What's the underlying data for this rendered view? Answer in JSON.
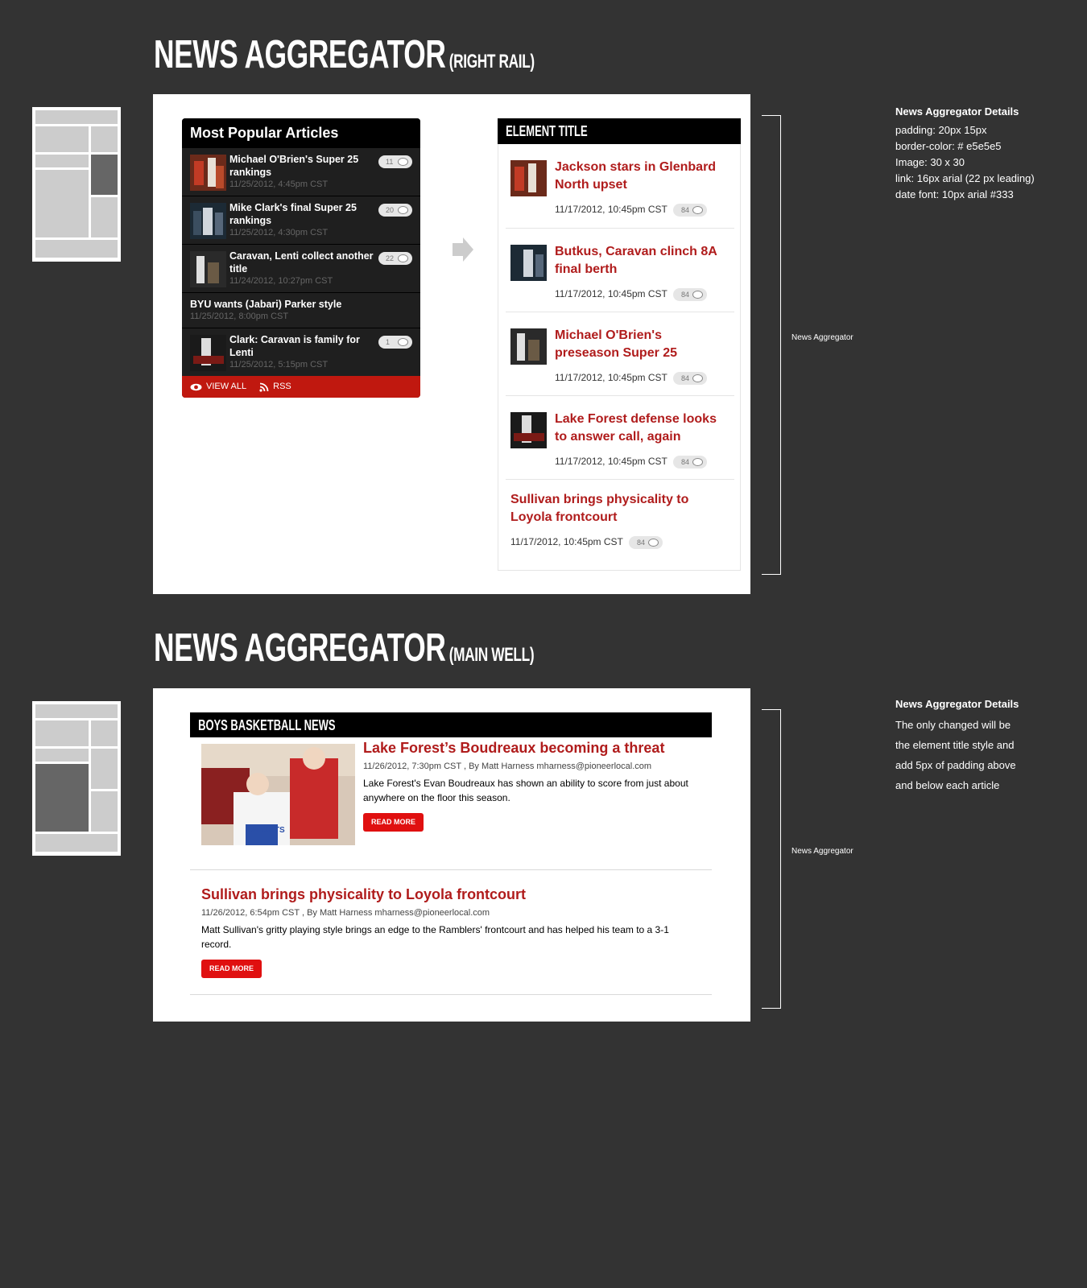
{
  "section1": {
    "title": "NEWS AGGREGATOR",
    "subtitle": "(RIGHT RAIL)"
  },
  "section2": {
    "title": "NEWS AGGREGATOR",
    "subtitle": "(MAIN WELL)"
  },
  "popular": {
    "heading": "Most Popular Articles",
    "items": [
      {
        "title": "Michael O'Brien's Super 25 rankings",
        "date": "11/25/2012, 4:45pm CST",
        "count": "11"
      },
      {
        "title": "Mike Clark's final Super 25 rankings",
        "date": "11/25/2012, 4:30pm CST",
        "count": "20"
      },
      {
        "title": "Caravan, Lenti collect another title",
        "date": "11/24/2012, 10:27pm CST",
        "count": "22"
      },
      {
        "title": "BYU wants (Jabari) Parker style",
        "date": "11/25/2012, 8:00pm CST"
      },
      {
        "title": "Clark: Caravan is family for Lenti",
        "date": "11/25/2012, 5:15pm CST",
        "count": "1"
      }
    ],
    "view_all": "VIEW ALL",
    "rss": "RSS"
  },
  "element_list": {
    "heading": "ELEMENT TITLE",
    "items": [
      {
        "title": "Jackson stars in Glenbard North upset",
        "date": "11/17/2012, 10:45pm CST",
        "count": "84"
      },
      {
        "title": "Butkus, Caravan clinch 8A final berth",
        "date": "11/17/2012, 10:45pm CST",
        "count": "84"
      },
      {
        "title": "Michael O'Brien's preseason Super 25",
        "date": "11/17/2012, 10:45pm CST",
        "count": "84"
      },
      {
        "title": "Lake Forest defense looks to answer call, again",
        "date": "11/17/2012, 10:45pm CST",
        "count": "84"
      },
      {
        "title": "Sullivan brings physicality to Loyola frontcourt",
        "date": "11/17/2012, 10:45pm CST",
        "count": "84"
      }
    ]
  },
  "annotation1": {
    "label": "News Aggregator"
  },
  "annotation2": {
    "label": "News Aggregator"
  },
  "details1": {
    "heading": "News Aggregator Details",
    "lines": [
      "padding: 20px 15px",
      "border-color: # e5e5e5",
      "Image: 30 x 30",
      "link: 16px arial (22 px leading)",
      "date font: 10px arial #333"
    ]
  },
  "details2": {
    "heading": "News Aggregator Details",
    "lines": [
      "The only changed will be",
      "the element title style and",
      "add 5px of padding above",
      "and below each article"
    ]
  },
  "main_well": {
    "heading": "BOYS BASKETBALL NEWS",
    "articles": [
      {
        "title": "Lake Forest’s Boudreaux becoming a threat",
        "meta": "11/26/2012, 7:30pm CST , By Matt Harness mharness@pioneerlocal.com",
        "summary": "Lake Forest's Evan Boudreaux has shown an ability to score from just about anywhere on the floor this season.",
        "button": "READ MORE",
        "jersey_text": "SCOUTS"
      },
      {
        "title": "Sullivan brings physicality to Loyola frontcourt",
        "meta": "11/26/2012, 6:54pm CST , By Matt Harness mharness@pioneerlocal.com",
        "summary": "Matt Sullivan's gritty playing style brings an edge to the Ramblers' frontcourt and has helped his team to a 3-1 record.",
        "button": "READ MORE"
      }
    ]
  },
  "colors": {
    "background": "#333333",
    "accent_red": "#b01c1c",
    "button_red": "#e01010",
    "footer_red": "#c0180f",
    "border": "#e5e5e5"
  },
  "icons": {
    "view_all": "eye-icon",
    "rss": "rss-icon",
    "comment": "comment-bubble-icon",
    "arrow": "right-arrow-icon"
  }
}
